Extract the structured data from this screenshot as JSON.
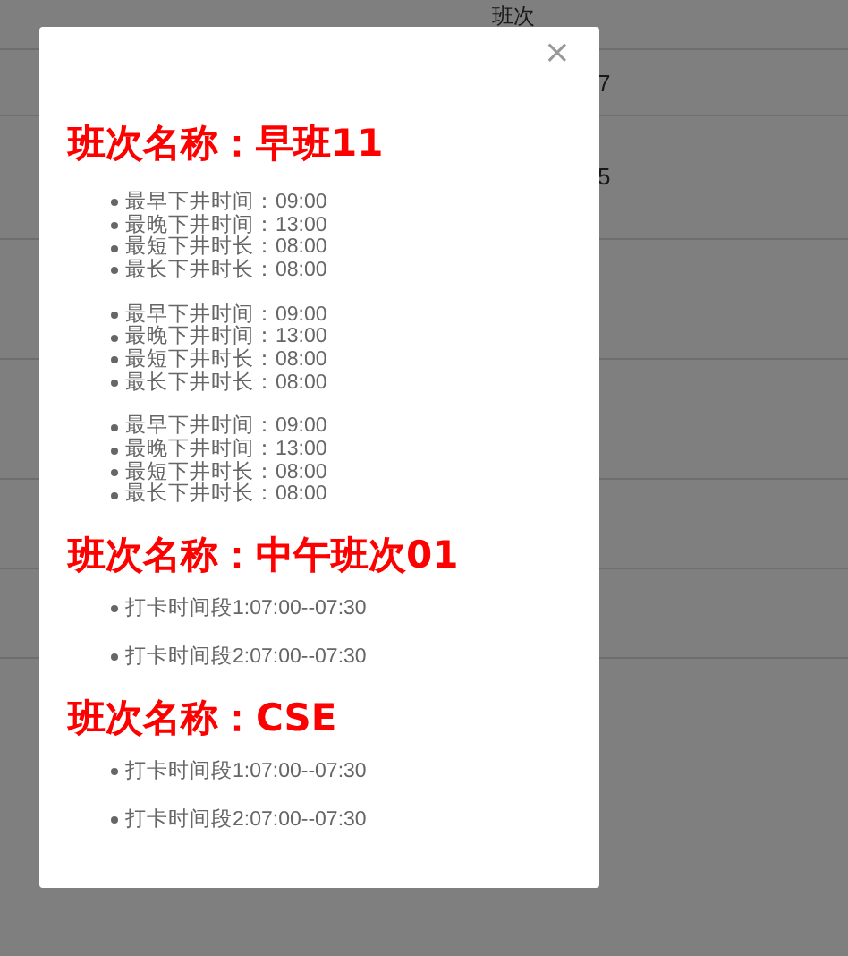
{
  "background_table": {
    "header": "班次",
    "rows": [
      {
        "cell": "7"
      },
      {
        "cell": "5"
      }
    ]
  },
  "dialog": {
    "close": "×",
    "sections": [
      {
        "title": "班次名称：早班11",
        "kind": "limits",
        "groups": [
          [
            "最早下井时间：09:00",
            "最晚下井时间：13:00",
            "最短下井时长：08:00",
            "最长下井时长：08:00"
          ],
          [
            "最早下井时间：09:00",
            "最晚下井时间：13:00",
            "最短下井时长：08:00",
            "最长下井时长：08:00"
          ],
          [
            "最早下井时间：09:00",
            "最晚下井时间：13:00",
            "最短下井时长：08:00",
            "最长下井时长：08:00"
          ]
        ]
      },
      {
        "title": "班次名称：中午班次01",
        "kind": "punch",
        "groups": [
          [
            "打卡时间段1:07:00--07:30",
            "打卡时间段2:07:00--07:30"
          ]
        ]
      },
      {
        "title": "班次名称：CSE",
        "kind": "punch",
        "groups": [
          [
            "打卡时间段1:07:00--07:30",
            "打卡时间段2:07:00--07:30"
          ]
        ]
      }
    ]
  }
}
